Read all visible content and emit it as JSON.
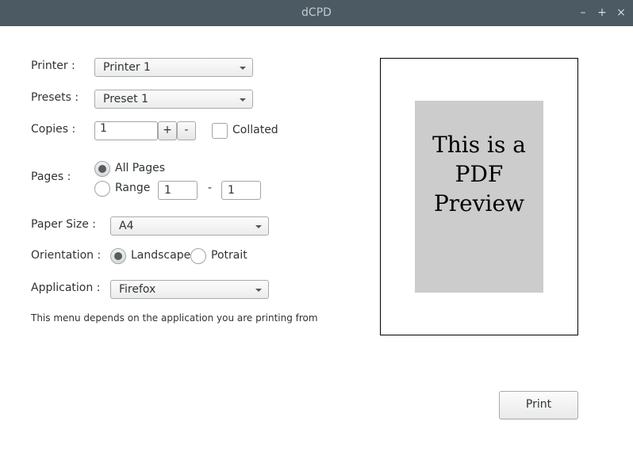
{
  "window": {
    "title": "dCPD",
    "minimize": "–",
    "maximize": "+",
    "close": "×"
  },
  "printer": {
    "label": "Printer :",
    "value": "Printer 1"
  },
  "presets": {
    "label": "Presets :",
    "value": "Preset 1"
  },
  "copies": {
    "label": "Copies :",
    "value": "1",
    "plus": "+",
    "minus": "-",
    "collated_label": "Collated",
    "collated_checked": false
  },
  "pages": {
    "label": "Pages :",
    "all_label": "All Pages",
    "range_label": "Range",
    "selected": "all",
    "range_from": "1",
    "range_sep": "-",
    "range_to": "1"
  },
  "paper_size": {
    "label": "Paper Size :",
    "value": "A4"
  },
  "orientation": {
    "label": "Orientation :",
    "landscape_label": "Landscape",
    "portrait_label": "Potrait",
    "selected": "landscape"
  },
  "application": {
    "label": "Application :",
    "value": "Firefox",
    "note": "This menu depends on the application you are printing from"
  },
  "preview": {
    "line1": "This is a",
    "line2": "PDF",
    "line3": "Preview"
  },
  "print_button": "Print",
  "colors": {
    "titlebar": "#4b5a63",
    "preview_page": "#cccccc"
  }
}
